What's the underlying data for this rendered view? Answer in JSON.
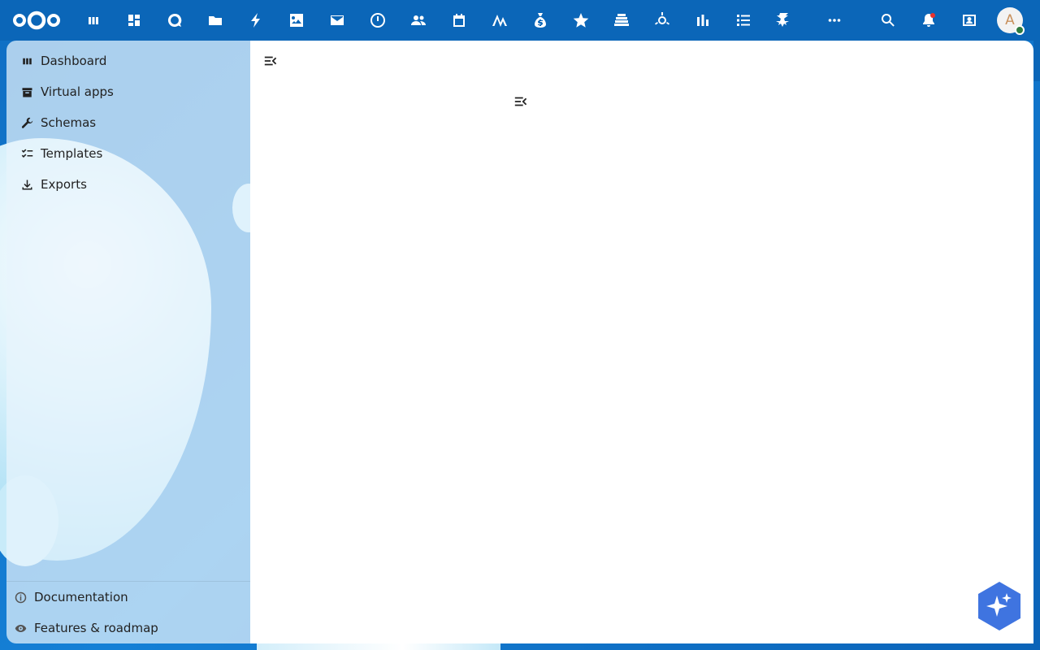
{
  "header": {
    "apps": [
      {
        "name": "dashboard-app-icon"
      },
      {
        "name": "apps-grid-icon"
      },
      {
        "name": "talk-icon"
      },
      {
        "name": "files-icon"
      },
      {
        "name": "activity-icon"
      },
      {
        "name": "photos-icon"
      },
      {
        "name": "mail-icon"
      },
      {
        "name": "clock-icon"
      },
      {
        "name": "contacts-icon"
      },
      {
        "name": "calendar-icon"
      },
      {
        "name": "analytics-icon"
      },
      {
        "name": "money-bag-icon"
      },
      {
        "name": "favorites-icon"
      },
      {
        "name": "deck-icon"
      },
      {
        "name": "integration-icon"
      },
      {
        "name": "chart-icon"
      },
      {
        "name": "tasks-icon"
      },
      {
        "name": "settings-app-icon"
      }
    ],
    "more_label": "···",
    "avatar_letter": "A"
  },
  "sidebar": {
    "items": [
      {
        "label": "Dashboard",
        "icon": "dashboard-icon"
      },
      {
        "label": "Virtual apps",
        "icon": "archive-icon"
      },
      {
        "label": "Schemas",
        "icon": "wrench-icon"
      },
      {
        "label": "Templates",
        "icon": "checklist-icon"
      },
      {
        "label": "Exports",
        "icon": "download-icon"
      }
    ],
    "footer": [
      {
        "label": "Documentation",
        "icon": "info-icon"
      },
      {
        "label": "Features & roadmap",
        "icon": "eye-icon"
      }
    ]
  },
  "colors": {
    "header_bg": "#0b66b8",
    "assistant": "#3f74e0"
  }
}
